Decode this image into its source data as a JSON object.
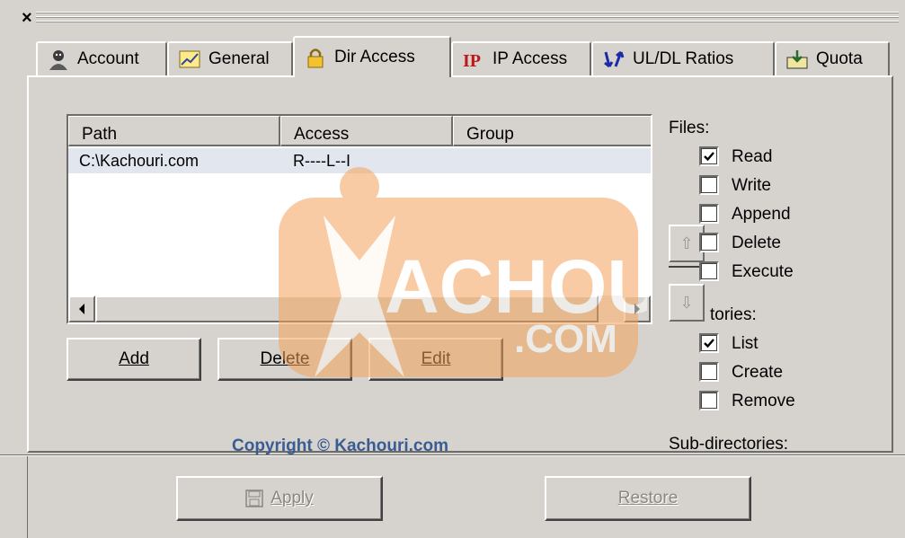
{
  "window": {
    "close_glyph": "×"
  },
  "tabs": [
    {
      "label": "Account",
      "icon": "user-icon"
    },
    {
      "label": "General",
      "icon": "chart-icon"
    },
    {
      "label": "Dir Access",
      "icon": "lock-icon",
      "active": true
    },
    {
      "label": "IP Access",
      "icon": "ip-icon"
    },
    {
      "label": "UL/DL Ratios",
      "icon": "ratio-icon"
    },
    {
      "label": "Quota",
      "icon": "quota-icon"
    }
  ],
  "list": {
    "columns": [
      "Path",
      "Access",
      "Group"
    ],
    "rows": [
      {
        "path": "C:\\Kachouri.com",
        "access": "R----L--I",
        "group": ""
      }
    ]
  },
  "buttons": {
    "add": "Add",
    "delete": "Delete",
    "edit": "Edit",
    "apply": "Apply",
    "restore": "Restore"
  },
  "files": {
    "title": "Files:",
    "options": [
      {
        "label": "Read",
        "checked": true
      },
      {
        "label": "Write",
        "checked": false
      },
      {
        "label": "Append",
        "checked": false
      },
      {
        "label": "Delete",
        "checked": false
      },
      {
        "label": "Execute",
        "checked": false
      }
    ]
  },
  "directories": {
    "title_partial": "tories:",
    "options": [
      {
        "label": "List",
        "checked": true
      },
      {
        "label": "Create",
        "checked": false
      },
      {
        "label": "Remove",
        "checked": false
      }
    ]
  },
  "subdirs": {
    "title": "Sub-directories:"
  },
  "watermark": {
    "text_main": "ACHOURI",
    "text_sub": ".COM"
  },
  "copyright": "Copyright © Kachouri.com",
  "colors": {
    "face": "#d6d3ce",
    "row_highlight": "#e2e6ee",
    "watermark": "#f0a060",
    "copyright": "#3a5c94"
  }
}
